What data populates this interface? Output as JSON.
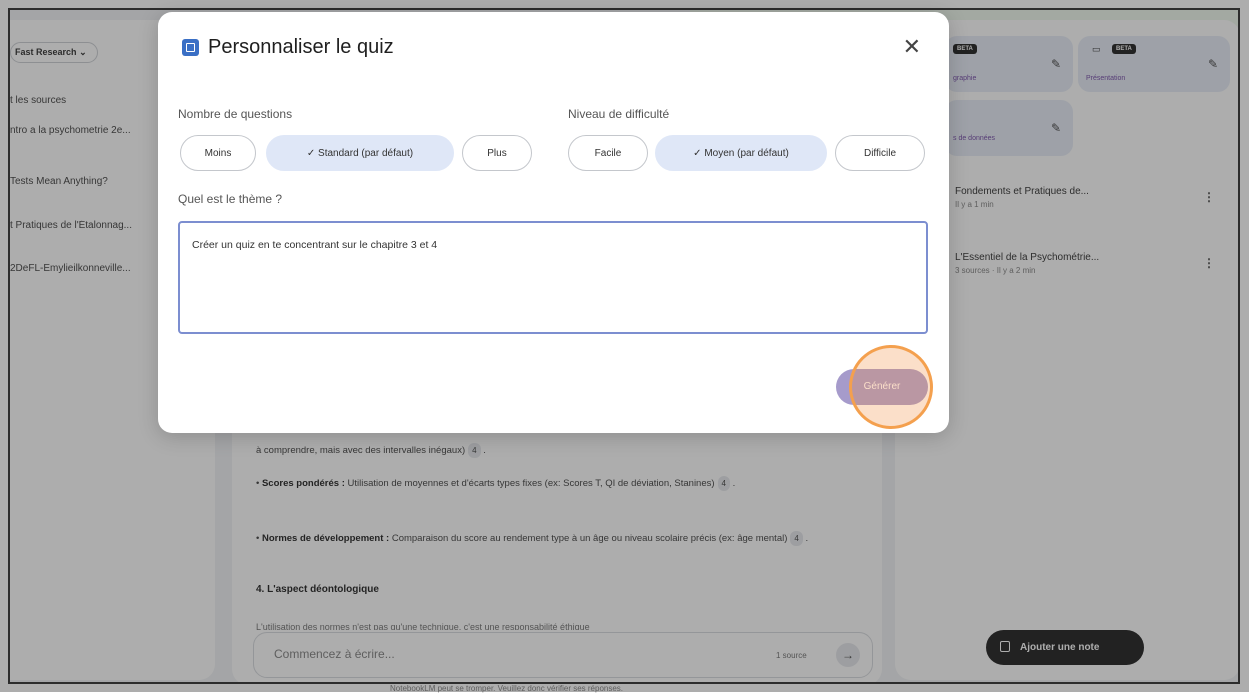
{
  "sidebar": {
    "research_label": "Fast Research",
    "research_chevron": "chevron-down-icon",
    "sources": [
      "t les sources",
      "ntro a la psychometrie 2e...",
      "Tests Mean Anything?",
      "t Pratiques de l'Étalonnag...",
      "2DeFL-Emylieilkonneville..."
    ]
  },
  "studio": {
    "tile_badge": "BETA",
    "tile1_label": "graphie",
    "tile2_label": "Présentation",
    "tile3_label": "s de données",
    "notes": [
      {
        "title": "Fondements et Pratiques de...",
        "meta": "Il y a 1 min"
      },
      {
        "title": "L'Essentiel de la Psychométrie...",
        "meta": "3 sources · Il y a 2 min"
      }
    ],
    "add_note_label": "Ajouter une note"
  },
  "center": {
    "para1": "à comprendre, mais avec des intervalles inégaux)",
    "cite1": "4",
    "para2_bold": "Scores pondérés :",
    "para2": " Utilisation de moyennes et d'écarts types fixes (ex: Scores T, QI de déviation, Stanines)",
    "cite2": "4",
    "para3_bold": "Normes de développement :",
    "para3": " Comparaison du score au rendement type à un âge ou niveau scolaire précis (ex: âge mental)",
    "cite3": "4",
    "heading": "4. L'aspect déontologique",
    "cut_line": "L'utilisation des normes n'est pas qu'une technique, c'est une responsabilité éthique",
    "chat_placeholder": "Commencez à écrire...",
    "chat_count": "1 source",
    "disclaimer": "NotebookLM peut se tromper. Veuillez donc vérifier ses réponses."
  },
  "modal": {
    "title": "Personnaliser le quiz",
    "close_icon": "close-icon",
    "count_label": "Nombre de questions",
    "count_options": [
      "Moins",
      "✓  Standard (par défaut)",
      "Plus"
    ],
    "difficulty_label": "Niveau de difficulté",
    "difficulty_options": [
      "Facile",
      "✓  Moyen (par défaut)",
      "Difficile"
    ],
    "theme_label": "Quel est le thème ?",
    "theme_value": "Créer un quiz en te concentrant sur le chapitre 3 et 4",
    "generate_label": "Générer"
  },
  "colors": {
    "accent": "#3a6fc5",
    "selected_pill": "#dfe7f7",
    "generate_button": "#a69bcb",
    "highlight": "#f4a04e"
  }
}
